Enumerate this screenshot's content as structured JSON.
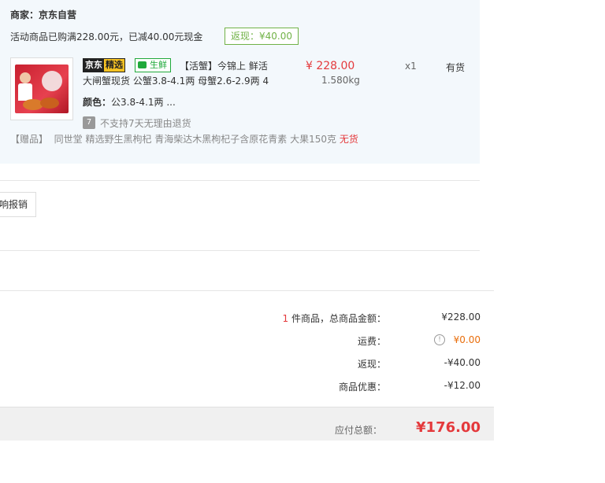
{
  "store": {
    "merchant": "商家：京东自营",
    "promo": "活动商品已购满228.00元，已减40.00元现金",
    "fanxian_badge": "返现：¥40.00"
  },
  "item": {
    "tag_jd_a": "京东",
    "tag_jd_b": "精选",
    "tag_fresh": "生鲜",
    "title_line1": "【活蟹】今锦上 鲜活",
    "title_line2": "大闸蟹现货 公蟹3.8-4.1两 母蟹2.6-2.9两 4",
    "color_label": "颜色：",
    "color_value": "公3.8-4.1两 ...",
    "price": "¥ 228.00",
    "weight": "1.580kg",
    "qty": "x1",
    "stock": "有货",
    "return_icon": "7",
    "return_policy": "不支持7天无理由退货",
    "gift_prefix": "【赠品】",
    "gift_text": "同世堂 精选野生黑枸杞 青海柴达木黑枸杞子含原花青素 大果150克",
    "gift_status": "无货"
  },
  "invoice": {
    "button_label": "响报销"
  },
  "summary": {
    "count": "1",
    "count_label": "件商品，总商品金额：",
    "goods_total": "¥228.00",
    "shipping_label": "运费：",
    "shipping_value": "¥0.00",
    "fanxian_label": "返现：",
    "fanxian_value": "-¥40.00",
    "discount_label": "商品优惠：",
    "discount_value": "-¥12.00",
    "payable_label": "应付总额：",
    "payable_value": "¥176.00"
  },
  "colors": {
    "price_red": "#e4393c",
    "fresh_green": "#20a93b",
    "fanxian_green": "#71b247",
    "shipping_orange": "#e96e0c",
    "panel_bg": "#f3f8fc"
  }
}
